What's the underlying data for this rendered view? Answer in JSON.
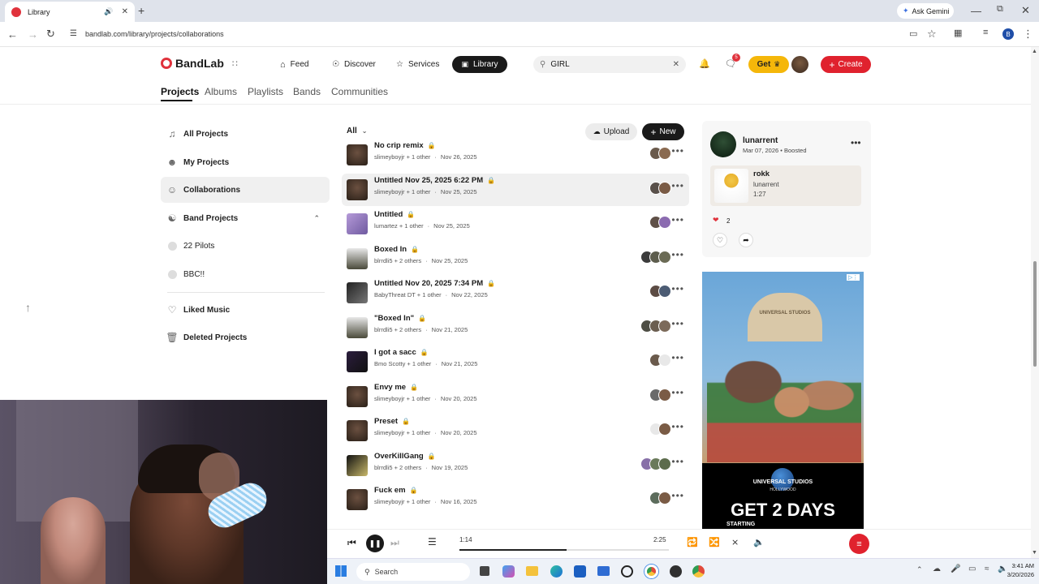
{
  "browser": {
    "tab_title": "Library",
    "url": "bandlab.com/library/projects/collaborations",
    "ask_gemini": "Ask Gemini",
    "profile_initial": "B"
  },
  "site": {
    "logo": "BandLab",
    "nav": {
      "feed": "Feed",
      "discover": "Discover",
      "services": "Services",
      "library": "Library"
    },
    "search_value": "GIRL",
    "notification_badge": "5",
    "get_label": "Get",
    "create_label": "Create",
    "subtabs": [
      "Projects",
      "Albums",
      "Playlists",
      "Bands",
      "Communities"
    ]
  },
  "sidebar": {
    "all_projects": "All Projects",
    "my_projects": "My Projects",
    "collaborations": "Collaborations",
    "band_projects": "Band Projects",
    "bands": [
      "22 Pilots",
      "BBC!!"
    ],
    "liked_music": "Liked Music",
    "deleted_projects": "Deleted Projects"
  },
  "list": {
    "filter": "All",
    "upload_label": "Upload",
    "new_label": "New",
    "projects": [
      {
        "title": "No crip remix",
        "owner": "slimeyboyjr + 1 other",
        "date": "Nov 26, 2025"
      },
      {
        "title": "Untitled Nov 25, 2025 6:22 PM",
        "owner": "slimeyboyjr + 1 other",
        "date": "Nov 25, 2025"
      },
      {
        "title": "Untitled",
        "owner": "lumartez + 1 other",
        "date": "Nov 25, 2025"
      },
      {
        "title": "Boxed In",
        "owner": "blrrdli5 + 2 others",
        "date": "Nov 25, 2025"
      },
      {
        "title": "Untitled Nov 20, 2025 7:34 PM",
        "owner": "BabyThreat DT + 1 other",
        "date": "Nov 22, 2025"
      },
      {
        "title": "\"Boxed In\"",
        "owner": "blrrdli5 + 2 others",
        "date": "Nov 21, 2025"
      },
      {
        "title": "I got a sacc",
        "owner": "Bmo Scotty + 1 other",
        "date": "Nov 21, 2025"
      },
      {
        "title": "Envy me",
        "owner": "slimeyboyjr + 1 other",
        "date": "Nov 20, 2025"
      },
      {
        "title": "Preset",
        "owner": "slimeyboyjr + 1 other",
        "date": "Nov 20, 2025"
      },
      {
        "title": "OverKillGang",
        "owner": "blrrdli5 + 2 others",
        "date": "Nov 19, 2025"
      },
      {
        "title": "Fuck em",
        "owner": "slimeyboyjr + 1 other",
        "date": "Nov 16, 2025"
      }
    ]
  },
  "post": {
    "user": "lunarrent",
    "meta": "Mar 07, 2026 • Boosted",
    "track_title": "rokk",
    "track_artist": "lunarrent",
    "track_duration": "1:27",
    "likes": "2"
  },
  "ad": {
    "headline": "GET 2 DAYS",
    "subline": "STARTING",
    "brand": "UNIVERSAL STUDIOS",
    "brand_sub": "HOLLYWOOD",
    "sign": "UNIVERSAL STUDIOS"
  },
  "player": {
    "current": "1:14",
    "total": "2:25",
    "progress": 0.51
  },
  "taskbar": {
    "search": "Search",
    "time": "3:41 AM",
    "date": "3/20/2026"
  }
}
